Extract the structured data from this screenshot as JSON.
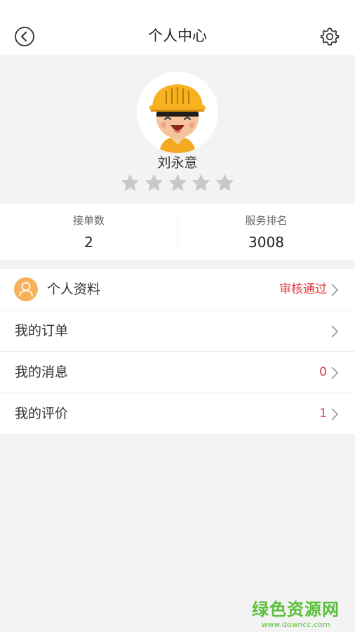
{
  "header": {
    "title": "个人中心",
    "back_icon": "back-circle-icon",
    "settings_icon": "gear-icon"
  },
  "profile": {
    "name": "刘永意",
    "rating": 0,
    "rating_max": 5
  },
  "stats": [
    {
      "label": "接单数",
      "value": "2"
    },
    {
      "label": "服务排名",
      "value": "3008"
    }
  ],
  "menu": {
    "profile": {
      "label": "个人资料",
      "status": "审核通过"
    },
    "orders": {
      "label": "我的订单",
      "value": ""
    },
    "messages": {
      "label": "我的消息",
      "value": "0"
    },
    "reviews": {
      "label": "我的评价",
      "value": "1"
    }
  },
  "watermark": {
    "main": "绿色资源网",
    "sub": "www.downcc.com"
  },
  "colors": {
    "accent_red": "#e4393c",
    "avatar_orange": "#f7b15a",
    "star_gray": "#c8c8c8",
    "watermark_green": "#5bbf3a"
  }
}
